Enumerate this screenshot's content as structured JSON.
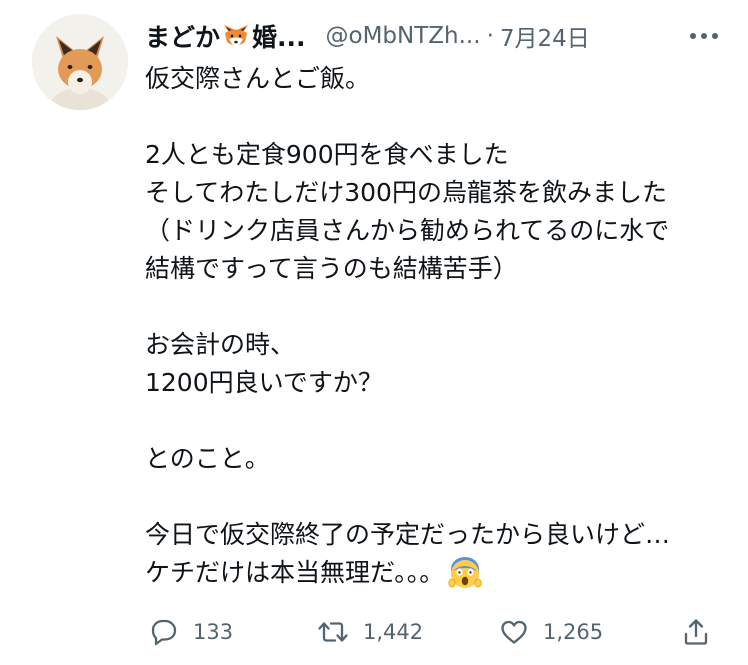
{
  "tweet": {
    "display_name_prefix": "まどか",
    "display_name_emoji": "fox-face-emoji",
    "display_name_suffix": "婚...",
    "handle": "@oMbNTZh...",
    "separator": "·",
    "date": "7月24日",
    "body_lines": [
      "仮交際さんとご飯。",
      "",
      "2人とも定食900円を食べました",
      "そしてわたしだけ300円の烏龍茶を飲みました",
      "（ドリンク店員さんから勧められてるのに水で",
      "結構ですって言うのも結構苦手）",
      "",
      "お会計の時、",
      "1200円良いですか？",
      "",
      "とのこと。",
      "",
      "今日で仮交際終了の予定だったから良いけど…",
      "ケチだけは本当無理だ。。。"
    ],
    "last_line_emoji": "face-screaming-in-fear-emoji",
    "actions": {
      "reply_count": "133",
      "retweet_count": "1,442",
      "like_count": "1,265"
    },
    "colors": {
      "text": "#0f1419",
      "secondary": "#536471"
    }
  }
}
